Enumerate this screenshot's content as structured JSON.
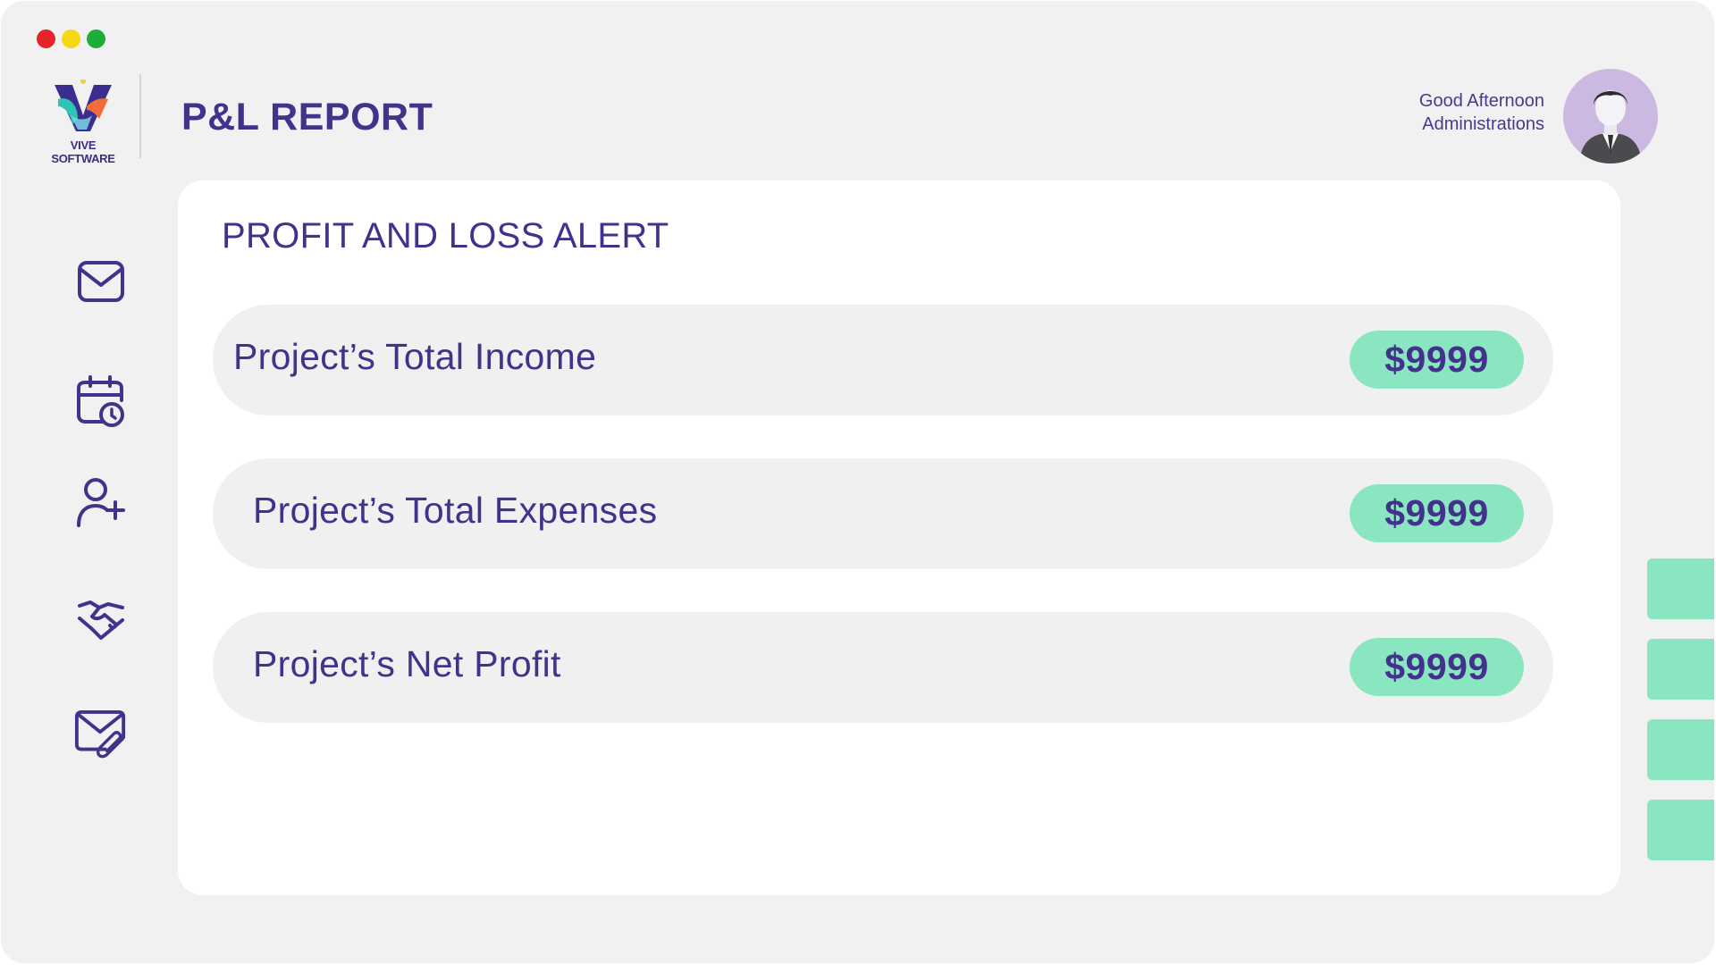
{
  "window": {
    "controls": [
      "close",
      "minimize",
      "maximize"
    ]
  },
  "brand": {
    "name": "VIVE SOFTWARE"
  },
  "header": {
    "title": "P&L REPORT",
    "greeting_line1": "Good Afternoon",
    "greeting_line2": "Administrations"
  },
  "sidebar": {
    "items": [
      {
        "icon": "mail-icon"
      },
      {
        "icon": "calendar-clock-icon"
      },
      {
        "icon": "add-user-icon"
      },
      {
        "icon": "handshake-icon"
      },
      {
        "icon": "mail-attachment-icon"
      }
    ]
  },
  "panel": {
    "title": "PROFIT AND LOSS ALERT",
    "rows": [
      {
        "label": "Project’s Total Income",
        "amount": "$9999"
      },
      {
        "label": "Project’s Total Expenses",
        "amount": "$9999"
      },
      {
        "label": "Project’s Net Profit",
        "amount": "$9999"
      }
    ]
  },
  "colors": {
    "accent": "#43328c",
    "mint": "#8ae6c1",
    "background": "#f0f1f0",
    "panel": "#ffffff"
  }
}
